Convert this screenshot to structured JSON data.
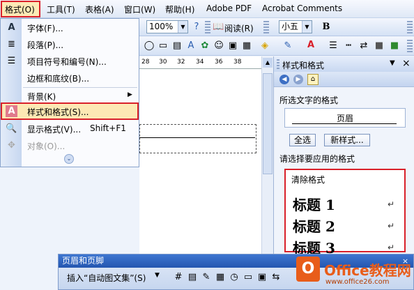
{
  "menubar": {
    "items": [
      "格式(O)",
      "工具(T)",
      "表格(A)",
      "窗口(W)",
      "帮助(H)",
      "Adobe PDF",
      "Acrobat Comments"
    ]
  },
  "toolbar1": {
    "zoom": "100%",
    "reading": "阅读(R)"
  },
  "toolbar2": {
    "font_size": "小五",
    "bold": "B"
  },
  "ruler": {
    "ticks": [
      "28",
      "30",
      "32",
      "34",
      "36",
      "38"
    ]
  },
  "format_menu": {
    "items": [
      {
        "icon": "font-icon",
        "label": "字体(F)..."
      },
      {
        "icon": "paragraph-icon",
        "label": "段落(P)..."
      },
      {
        "icon": "bullets-icon",
        "label": "项目符号和编号(N)..."
      },
      {
        "icon": "",
        "label": "边框和底纹(B)..."
      },
      {
        "icon": "",
        "label": "背景(K)"
      },
      {
        "icon": "styles-icon",
        "label": "样式和格式(S)..."
      },
      {
        "icon": "reveal-format-icon",
        "label": "显示格式(V)...",
        "shortcut": "Shift+F1"
      },
      {
        "icon": "object-icon",
        "label": "对象(O)..."
      }
    ]
  },
  "task_pane": {
    "title": "样式和格式",
    "selected_label": "所选文字的格式",
    "selected_style": "页眉",
    "select_all": "全选",
    "new_style": "新样式...",
    "apply_label": "请选择要应用的格式",
    "styles": [
      "清除格式",
      "标题 1",
      "标题 2",
      "标题 3"
    ],
    "return_mark": "↵"
  },
  "header_footer_toolbar": {
    "title": "页眉和页脚",
    "insert_autotext": "插入“自动图文集”(S)",
    "close": "×"
  },
  "watermark": {
    "brand": "Office教程网",
    "url": "www.office26.com"
  },
  "colors": {
    "highlight_red": "#d9202a",
    "menu_highlight": "#fde8b4",
    "office_orange": "#e85d1a"
  }
}
